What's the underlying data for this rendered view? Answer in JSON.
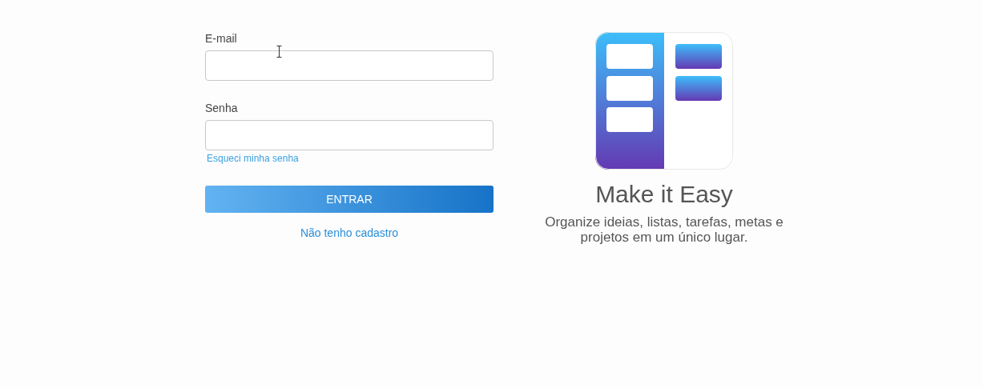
{
  "login_form": {
    "email_label": "E-mail",
    "password_label": "Senha",
    "forgot_link": "Esqueci minha senha",
    "submit_button": "ENTRAR",
    "signup_link": "Não tenho cadastro"
  },
  "promo": {
    "title": "Make it Easy",
    "description": "Organize ideias, listas, tarefas, metas e projetos em um único lugar."
  }
}
